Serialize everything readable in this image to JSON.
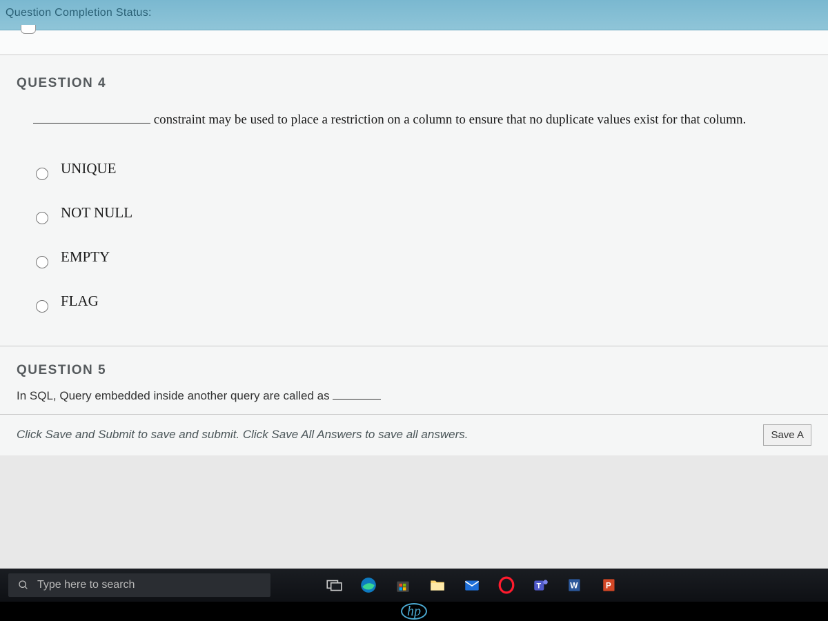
{
  "top_bar": {
    "label": "Question Completion Status:"
  },
  "question4": {
    "title": "QUESTION 4",
    "text": "constraint may be used to place a restriction on a column to ensure that no duplicate values exist for that column.",
    "options": [
      "UNIQUE",
      "NOT NULL",
      "EMPTY",
      "FLAG"
    ]
  },
  "question5": {
    "title": "QUESTION 5",
    "text": "In SQL, Query embedded inside another query are called as"
  },
  "instructions": "Click Save and Submit to save and submit. Click Save All Answers to save all answers.",
  "save_button": "Save A",
  "taskbar": {
    "search_placeholder": "Type here to search",
    "icons": {
      "teams": "T",
      "word": "W",
      "powerpoint": "P"
    },
    "hp": "hp"
  }
}
